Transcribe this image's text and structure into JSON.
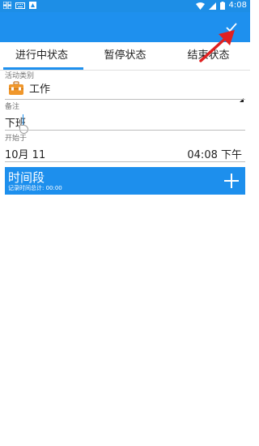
{
  "status_bar": {
    "time": "4:08",
    "icons": [
      "app-grid-icon",
      "keyboard-icon",
      "notification-icon",
      "wifi-icon",
      "signal-icon",
      "battery-icon"
    ]
  },
  "app_bar": {
    "action_icon": "check-icon",
    "background": "#1e90ee"
  },
  "tabs": [
    {
      "label": "进行中状态",
      "active": true
    },
    {
      "label": "暂停状态",
      "active": false
    },
    {
      "label": "结束状态",
      "active": false
    }
  ],
  "form": {
    "category_label": "活动类别",
    "category_value": "工作",
    "category_icon": "briefcase-icon",
    "note_label": "备注",
    "note_value": "下班",
    "start_label": "开始于",
    "start_date": "10月 11",
    "start_time": "04:08 下午"
  },
  "period": {
    "title": "时间段",
    "subtitle": "记录时间总计: 00:00",
    "add_icon": "plus-icon"
  },
  "colors": {
    "accent": "#1e90ee",
    "annotation_arrow": "#e02020",
    "briefcase": "#f0972b"
  }
}
